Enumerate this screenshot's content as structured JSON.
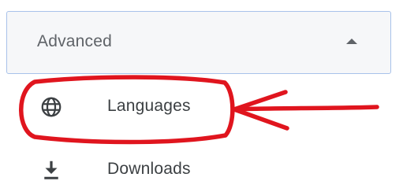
{
  "advanced": {
    "label": "Advanced",
    "expanded": true,
    "caret_icon": "caret-up-icon"
  },
  "menu": {
    "items": [
      {
        "label": "Languages",
        "icon": "globe-icon"
      },
      {
        "label": "Downloads",
        "icon": "download-icon"
      }
    ]
  },
  "colors": {
    "header_background": "#f6f7f9",
    "header_border": "#a8c2ea",
    "label_text": "#3c4043",
    "header_text": "#5f6368",
    "annotation_red": "#e0151e"
  }
}
